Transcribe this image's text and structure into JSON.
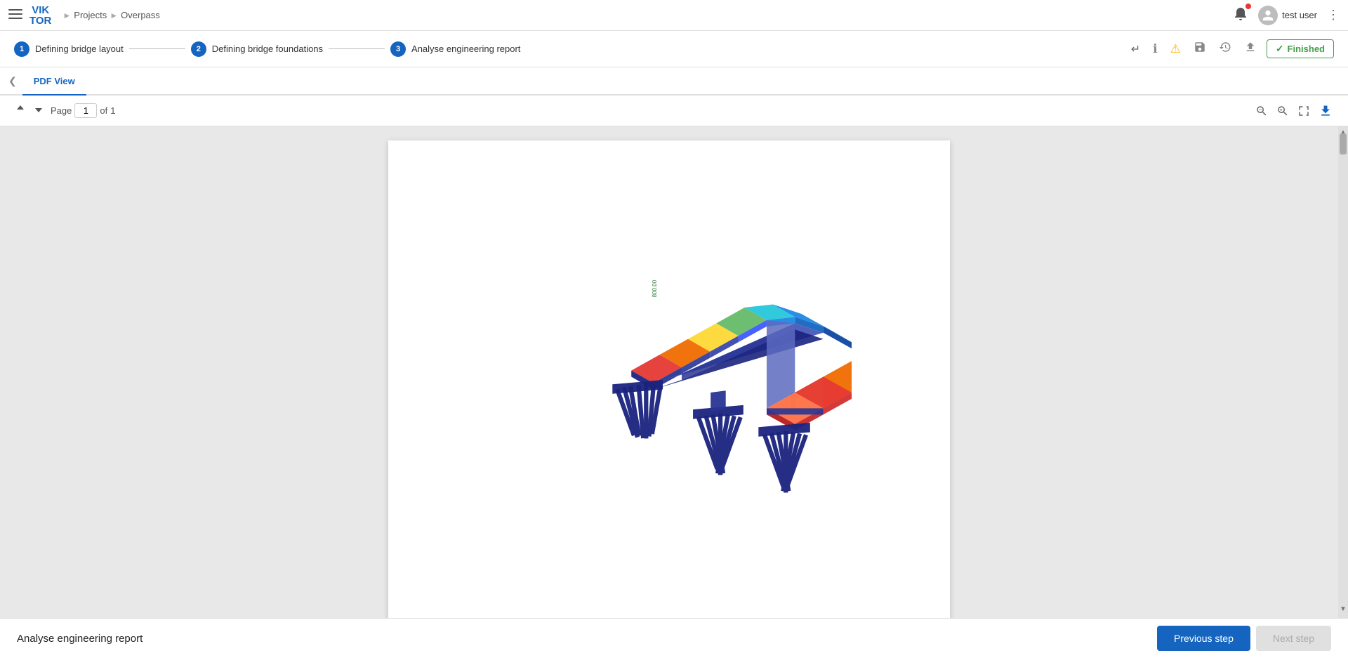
{
  "app": {
    "logo": "VIKTOR",
    "logo_top": "VIK",
    "logo_bottom": "TOR"
  },
  "breadcrumb": {
    "projects": "Projects",
    "separator1": "›",
    "current": "Overpass",
    "separator2": "›"
  },
  "workflow": {
    "steps": [
      {
        "number": "1",
        "label": "Defining bridge layout",
        "state": "active"
      },
      {
        "number": "2",
        "label": "Defining bridge foundations",
        "state": "active"
      },
      {
        "number": "3",
        "label": "Analyse engineering report",
        "state": "active"
      }
    ],
    "actions": {
      "finished_label": "Finished",
      "return_icon": "↵",
      "info_icon": "ℹ",
      "warning_icon": "⚠",
      "save_icon": "💾",
      "history_icon": "🕒",
      "upload_icon": "⬆"
    }
  },
  "tabs": [
    {
      "label": "PDF View",
      "active": true
    }
  ],
  "pdf_toolbar": {
    "page_up": "↑",
    "page_down": "↓",
    "page_label": "Page",
    "page_current": "1",
    "page_of": "of",
    "page_total": "1",
    "zoom_out_icon": "zoom-out",
    "zoom_in_icon": "zoom-in",
    "fit_icon": "fit-page",
    "download_icon": "download"
  },
  "bottom_bar": {
    "title": "Analyse engineering report",
    "prev_step": "Previous step",
    "next_step": "Next step"
  },
  "user": {
    "name": "test user",
    "avatar_initial": "👤"
  }
}
